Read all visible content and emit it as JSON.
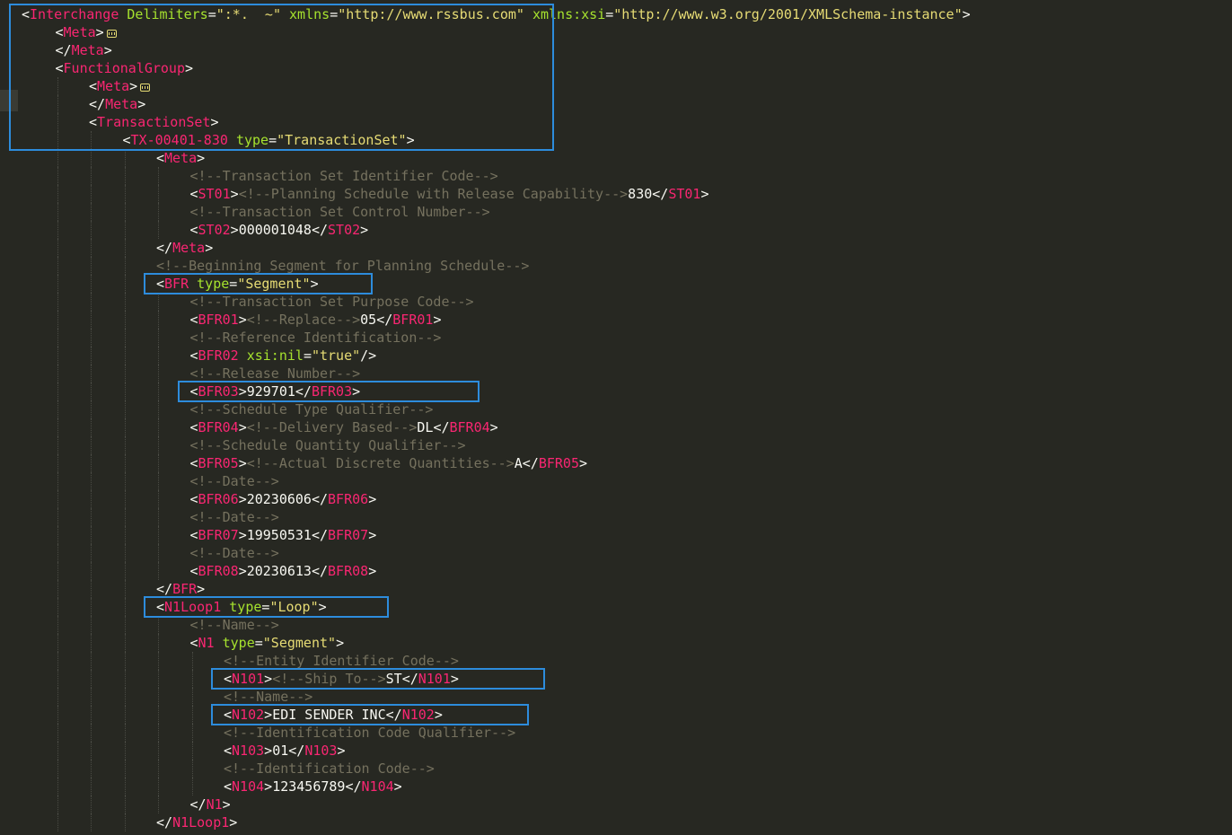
{
  "editor": {
    "colors": {
      "background": "#272822",
      "tag": "#F92672",
      "attribute": "#A6E22E",
      "string": "#E6DB74",
      "comment": "#75715E",
      "text": "#F8F8F2",
      "highlight_box": "#2D8CDC"
    },
    "lines": [
      {
        "indent": 0,
        "segs": [
          [
            "p",
            "<"
          ],
          [
            "t",
            "Interchange"
          ],
          [
            "x",
            " "
          ],
          [
            "a",
            "Delimiters"
          ],
          [
            "p",
            "="
          ],
          [
            "s",
            "\":*.  ~\""
          ],
          [
            "x",
            " "
          ],
          [
            "a",
            "xmlns"
          ],
          [
            "p",
            "="
          ],
          [
            "s",
            "\"http://www.rssbus.com\""
          ],
          [
            "x",
            " "
          ],
          [
            "a",
            "xmlns:xsi"
          ],
          [
            "p",
            "="
          ],
          [
            "s",
            "\"http://www.w3.org/2001/XMLSchema-instance\""
          ],
          [
            "p",
            ">"
          ]
        ]
      },
      {
        "indent": 1,
        "fold": true,
        "segs": [
          [
            "p",
            "<"
          ],
          [
            "t",
            "Meta"
          ],
          [
            "p",
            ">"
          ]
        ]
      },
      {
        "indent": 1,
        "segs": [
          [
            "p",
            "</"
          ],
          [
            "t",
            "Meta"
          ],
          [
            "p",
            ">"
          ]
        ]
      },
      {
        "indent": 1,
        "segs": [
          [
            "p",
            "<"
          ],
          [
            "t",
            "FunctionalGroup"
          ],
          [
            "p",
            ">"
          ]
        ]
      },
      {
        "indent": 2,
        "fold": true,
        "segs": [
          [
            "p",
            "<"
          ],
          [
            "t",
            "Meta"
          ],
          [
            "p",
            ">"
          ]
        ]
      },
      {
        "indent": 2,
        "segs": [
          [
            "p",
            "</"
          ],
          [
            "t",
            "Meta"
          ],
          [
            "p",
            ">"
          ]
        ]
      },
      {
        "indent": 2,
        "segs": [
          [
            "p",
            "<"
          ],
          [
            "t",
            "TransactionSet"
          ],
          [
            "p",
            ">"
          ]
        ]
      },
      {
        "indent": 3,
        "segs": [
          [
            "p",
            "<"
          ],
          [
            "t",
            "TX-00401-830"
          ],
          [
            "x",
            " "
          ],
          [
            "a",
            "type"
          ],
          [
            "p",
            "="
          ],
          [
            "s",
            "\"TransactionSet\""
          ],
          [
            "p",
            ">"
          ]
        ]
      },
      {
        "indent": 4,
        "segs": [
          [
            "p",
            "<"
          ],
          [
            "t",
            "Meta"
          ],
          [
            "p",
            ">"
          ]
        ]
      },
      {
        "indent": 5,
        "segs": [
          [
            "c",
            "<!--Transaction Set Identifier Code-->"
          ]
        ]
      },
      {
        "indent": 5,
        "segs": [
          [
            "p",
            "<"
          ],
          [
            "t",
            "ST01"
          ],
          [
            "p",
            ">"
          ],
          [
            "c",
            "<!--Planning Schedule with Release Capability-->"
          ],
          [
            "x",
            "830"
          ],
          [
            "p",
            "</"
          ],
          [
            "t",
            "ST01"
          ],
          [
            "p",
            ">"
          ]
        ]
      },
      {
        "indent": 5,
        "segs": [
          [
            "c",
            "<!--Transaction Set Control Number-->"
          ]
        ]
      },
      {
        "indent": 5,
        "segs": [
          [
            "p",
            "<"
          ],
          [
            "t",
            "ST02"
          ],
          [
            "p",
            ">"
          ],
          [
            "x",
            "000001048"
          ],
          [
            "p",
            "</"
          ],
          [
            "t",
            "ST02"
          ],
          [
            "p",
            ">"
          ]
        ]
      },
      {
        "indent": 4,
        "segs": [
          [
            "p",
            "</"
          ],
          [
            "t",
            "Meta"
          ],
          [
            "p",
            ">"
          ]
        ]
      },
      {
        "indent": 4,
        "segs": [
          [
            "c",
            "<!--Beginning Segment for Planning Schedule-->"
          ]
        ]
      },
      {
        "indent": 4,
        "segs": [
          [
            "p",
            "<"
          ],
          [
            "t",
            "BFR"
          ],
          [
            "x",
            " "
          ],
          [
            "a",
            "type"
          ],
          [
            "p",
            "="
          ],
          [
            "s",
            "\"Segment\""
          ],
          [
            "p",
            ">"
          ]
        ]
      },
      {
        "indent": 5,
        "segs": [
          [
            "c",
            "<!--Transaction Set Purpose Code-->"
          ]
        ]
      },
      {
        "indent": 5,
        "segs": [
          [
            "p",
            "<"
          ],
          [
            "t",
            "BFR01"
          ],
          [
            "p",
            ">"
          ],
          [
            "c",
            "<!--Replace-->"
          ],
          [
            "x",
            "05"
          ],
          [
            "p",
            "</"
          ],
          [
            "t",
            "BFR01"
          ],
          [
            "p",
            ">"
          ]
        ]
      },
      {
        "indent": 5,
        "segs": [
          [
            "c",
            "<!--Reference Identification-->"
          ]
        ]
      },
      {
        "indent": 5,
        "segs": [
          [
            "p",
            "<"
          ],
          [
            "t",
            "BFR02"
          ],
          [
            "x",
            " "
          ],
          [
            "a",
            "xsi:nil"
          ],
          [
            "p",
            "="
          ],
          [
            "s",
            "\"true\""
          ],
          [
            "p",
            "/>"
          ]
        ]
      },
      {
        "indent": 5,
        "segs": [
          [
            "c",
            "<!--Release Number-->"
          ]
        ]
      },
      {
        "indent": 5,
        "segs": [
          [
            "p",
            "<"
          ],
          [
            "t",
            "BFR03"
          ],
          [
            "p",
            ">"
          ],
          [
            "x",
            "929701"
          ],
          [
            "p",
            "</"
          ],
          [
            "t",
            "BFR03"
          ],
          [
            "p",
            ">"
          ]
        ]
      },
      {
        "indent": 5,
        "segs": [
          [
            "c",
            "<!--Schedule Type Qualifier-->"
          ]
        ]
      },
      {
        "indent": 5,
        "segs": [
          [
            "p",
            "<"
          ],
          [
            "t",
            "BFR04"
          ],
          [
            "p",
            ">"
          ],
          [
            "c",
            "<!--Delivery Based-->"
          ],
          [
            "x",
            "DL"
          ],
          [
            "p",
            "</"
          ],
          [
            "t",
            "BFR04"
          ],
          [
            "p",
            ">"
          ]
        ]
      },
      {
        "indent": 5,
        "segs": [
          [
            "c",
            "<!--Schedule Quantity Qualifier-->"
          ]
        ]
      },
      {
        "indent": 5,
        "segs": [
          [
            "p",
            "<"
          ],
          [
            "t",
            "BFR05"
          ],
          [
            "p",
            ">"
          ],
          [
            "c",
            "<!--Actual Discrete Quantities-->"
          ],
          [
            "x",
            "A"
          ],
          [
            "p",
            "</"
          ],
          [
            "t",
            "BFR05"
          ],
          [
            "p",
            ">"
          ]
        ]
      },
      {
        "indent": 5,
        "segs": [
          [
            "c",
            "<!--Date-->"
          ]
        ]
      },
      {
        "indent": 5,
        "segs": [
          [
            "p",
            "<"
          ],
          [
            "t",
            "BFR06"
          ],
          [
            "p",
            ">"
          ],
          [
            "x",
            "20230606"
          ],
          [
            "p",
            "</"
          ],
          [
            "t",
            "BFR06"
          ],
          [
            "p",
            ">"
          ]
        ]
      },
      {
        "indent": 5,
        "segs": [
          [
            "c",
            "<!--Date-->"
          ]
        ]
      },
      {
        "indent": 5,
        "segs": [
          [
            "p",
            "<"
          ],
          [
            "t",
            "BFR07"
          ],
          [
            "p",
            ">"
          ],
          [
            "x",
            "19950531"
          ],
          [
            "p",
            "</"
          ],
          [
            "t",
            "BFR07"
          ],
          [
            "p",
            ">"
          ]
        ]
      },
      {
        "indent": 5,
        "segs": [
          [
            "c",
            "<!--Date-->"
          ]
        ]
      },
      {
        "indent": 5,
        "segs": [
          [
            "p",
            "<"
          ],
          [
            "t",
            "BFR08"
          ],
          [
            "p",
            ">"
          ],
          [
            "x",
            "20230613"
          ],
          [
            "p",
            "</"
          ],
          [
            "t",
            "BFR08"
          ],
          [
            "p",
            ">"
          ]
        ]
      },
      {
        "indent": 4,
        "segs": [
          [
            "p",
            "</"
          ],
          [
            "t",
            "BFR"
          ],
          [
            "p",
            ">"
          ]
        ]
      },
      {
        "indent": 4,
        "segs": [
          [
            "p",
            "<"
          ],
          [
            "t",
            "N1Loop1"
          ],
          [
            "x",
            " "
          ],
          [
            "a",
            "type"
          ],
          [
            "p",
            "="
          ],
          [
            "s",
            "\"Loop\""
          ],
          [
            "p",
            ">"
          ]
        ]
      },
      {
        "indent": 5,
        "segs": [
          [
            "c",
            "<!--Name-->"
          ]
        ]
      },
      {
        "indent": 5,
        "segs": [
          [
            "p",
            "<"
          ],
          [
            "t",
            "N1"
          ],
          [
            "x",
            " "
          ],
          [
            "a",
            "type"
          ],
          [
            "p",
            "="
          ],
          [
            "s",
            "\"Segment\""
          ],
          [
            "p",
            ">"
          ]
        ]
      },
      {
        "indent": 6,
        "segs": [
          [
            "c",
            "<!--Entity Identifier Code-->"
          ]
        ]
      },
      {
        "indent": 6,
        "segs": [
          [
            "p",
            "<"
          ],
          [
            "t",
            "N101"
          ],
          [
            "p",
            ">"
          ],
          [
            "c",
            "<!--Ship To-->"
          ],
          [
            "x",
            "ST"
          ],
          [
            "p",
            "</"
          ],
          [
            "t",
            "N101"
          ],
          [
            "p",
            ">"
          ]
        ]
      },
      {
        "indent": 6,
        "segs": [
          [
            "c",
            "<!--Name-->"
          ]
        ]
      },
      {
        "indent": 6,
        "segs": [
          [
            "p",
            "<"
          ],
          [
            "t",
            "N102"
          ],
          [
            "p",
            ">"
          ],
          [
            "x",
            "EDI SENDER INC"
          ],
          [
            "p",
            "</"
          ],
          [
            "t",
            "N102"
          ],
          [
            "p",
            ">"
          ]
        ]
      },
      {
        "indent": 6,
        "segs": [
          [
            "c",
            "<!--Identification Code Qualifier-->"
          ]
        ]
      },
      {
        "indent": 6,
        "segs": [
          [
            "p",
            "<"
          ],
          [
            "t",
            "N103"
          ],
          [
            "p",
            ">"
          ],
          [
            "x",
            "01"
          ],
          [
            "p",
            "</"
          ],
          [
            "t",
            "N103"
          ],
          [
            "p",
            ">"
          ]
        ]
      },
      {
        "indent": 6,
        "segs": [
          [
            "c",
            "<!--Identification Code-->"
          ]
        ]
      },
      {
        "indent": 6,
        "segs": [
          [
            "p",
            "<"
          ],
          [
            "t",
            "N104"
          ],
          [
            "p",
            ">"
          ],
          [
            "x",
            "123456789"
          ],
          [
            "p",
            "</"
          ],
          [
            "t",
            "N104"
          ],
          [
            "p",
            ">"
          ]
        ]
      },
      {
        "indent": 5,
        "segs": [
          [
            "p",
            "</"
          ],
          [
            "t",
            "N1"
          ],
          [
            "p",
            ">"
          ]
        ]
      },
      {
        "indent": 4,
        "segs": [
          [
            "p",
            "</"
          ],
          [
            "t",
            "N1Loop1"
          ],
          [
            "p",
            ">"
          ]
        ]
      }
    ],
    "highlights": [
      {
        "name": "interchange-header-block",
        "from": 0,
        "to": 7,
        "cols": [
          0,
          65
        ]
      },
      {
        "name": "bfr-segment-tag",
        "from": 15,
        "to": 15,
        "cols": [
          0,
          26
        ]
      },
      {
        "name": "bfr03-element",
        "from": 21,
        "to": 21,
        "cols": [
          0,
          35
        ]
      },
      {
        "name": "n1loop1-tag",
        "from": 33,
        "to": 33,
        "cols": [
          0,
          28
        ]
      },
      {
        "name": "n101-element",
        "from": 37,
        "to": 37,
        "cols": [
          0,
          39
        ]
      },
      {
        "name": "n102-element",
        "from": 39,
        "to": 39,
        "cols": [
          0,
          37
        ]
      }
    ]
  }
}
